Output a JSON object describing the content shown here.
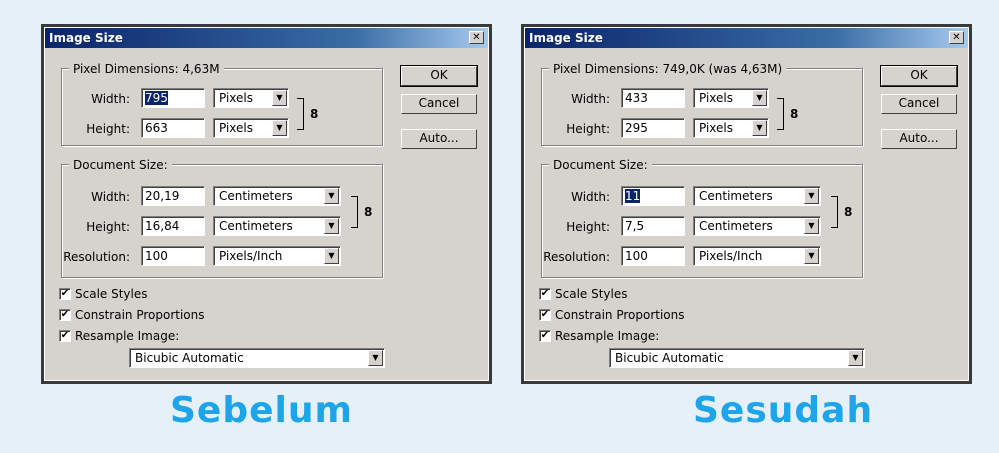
{
  "dialogs": [
    {
      "title": "Image Size",
      "close_glyph": "✕",
      "pixel_dimensions": {
        "label": "Pixel Dimensions:",
        "value": "4,63M",
        "width_label": "Width:",
        "width_value": "795",
        "width_unit": "Pixels",
        "height_label": "Height:",
        "height_value": "663",
        "height_unit": "Pixels"
      },
      "document_size": {
        "label": "Document Size:",
        "width_label": "Width:",
        "width_value": "20,19",
        "width_unit": "Centimeters",
        "height_label": "Height:",
        "height_value": "16,84",
        "height_unit": "Centimeters",
        "resolution_label": "Resolution:",
        "resolution_value": "100",
        "resolution_unit": "Pixels/Inch"
      },
      "buttons": {
        "ok": "OK",
        "cancel": "Cancel",
        "auto": "Auto..."
      },
      "checkboxes": [
        {
          "label": "Scale Styles",
          "checked": true
        },
        {
          "label": "Constrain Proportions",
          "checked": true
        },
        {
          "label": "Resample Image:",
          "checked": true
        }
      ],
      "resample_method": "Bicubic Automatic"
    },
    {
      "title": "Image Size",
      "close_glyph": "✕",
      "pixel_dimensions": {
        "label": "Pixel Dimensions:",
        "value": "749,0K (was 4,63M)",
        "width_label": "Width:",
        "width_value": "433",
        "width_unit": "Pixels",
        "height_label": "Height:",
        "height_value": "295",
        "height_unit": "Pixels"
      },
      "document_size": {
        "label": "Document Size:",
        "width_label": "Width:",
        "width_value": "11",
        "width_unit": "Centimeters",
        "height_label": "Height:",
        "height_value": "7,5",
        "height_unit": "Centimeters",
        "resolution_label": "Resolution:",
        "resolution_value": "100",
        "resolution_unit": "Pixels/Inch"
      },
      "buttons": {
        "ok": "OK",
        "cancel": "Cancel",
        "auto": "Auto..."
      },
      "checkboxes": [
        {
          "label": "Scale Styles",
          "checked": true
        },
        {
          "label": "Constrain Proportions",
          "checked": true
        },
        {
          "label": "Resample Image:",
          "checked": true
        }
      ],
      "resample_method": "Bicubic Automatic"
    }
  ],
  "captions": {
    "before": "Sebelum",
    "after": "Sesudah"
  },
  "symbols": {
    "check": "✔",
    "arrow": "▼",
    "link": "8"
  },
  "colors": {
    "caption": "#1ea4e8",
    "titlebar": "#0a246a",
    "dialog": "#d6d3ce",
    "selection": "#0a246a"
  }
}
